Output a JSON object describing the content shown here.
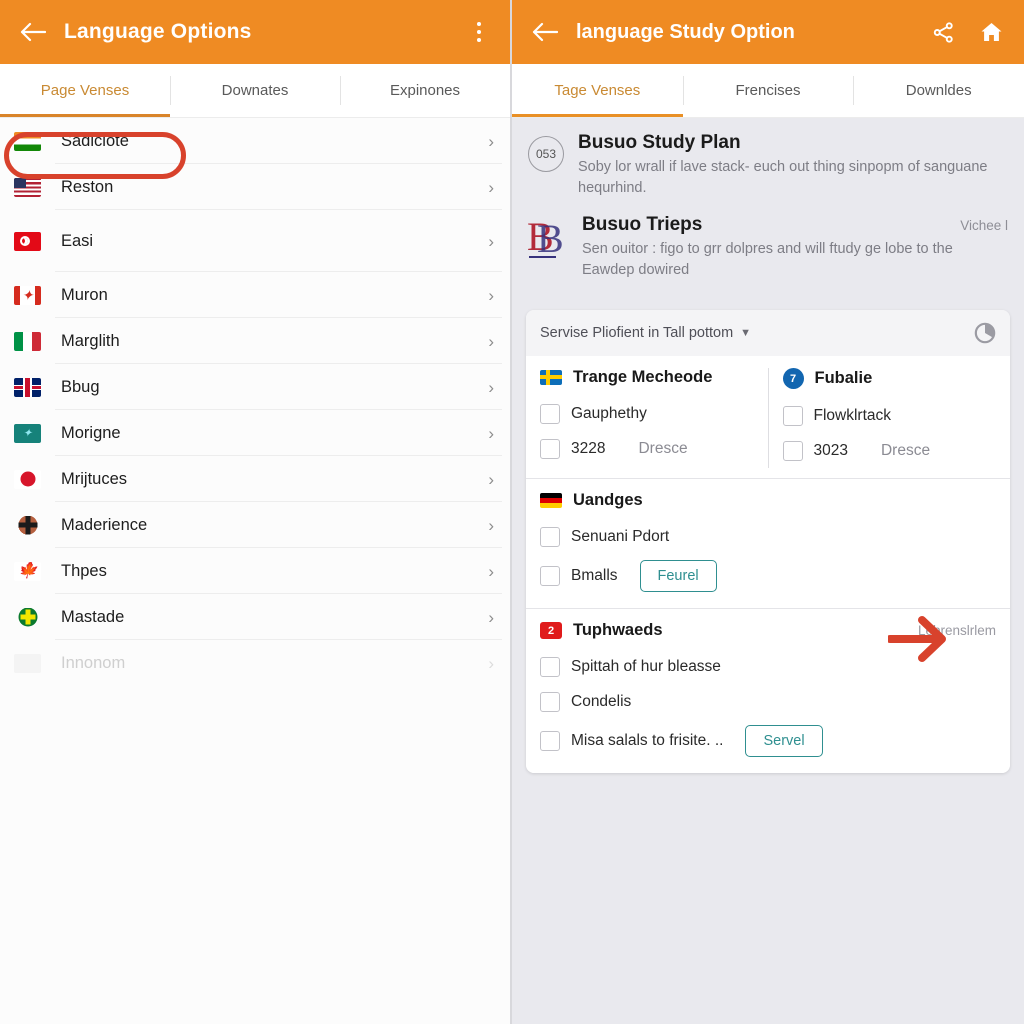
{
  "left": {
    "appbar": {
      "back_icon": "back-arrow-icon",
      "title": "Language Options",
      "overflow_icon": "more-vertical-icon"
    },
    "tabs": [
      {
        "label": "Page Venses",
        "active": true
      },
      {
        "label": "Downates",
        "active": false
      },
      {
        "label": "Expinones",
        "active": false
      }
    ],
    "highlight_color": "#d8422c",
    "languages": [
      {
        "label": "Sadiclote",
        "flag": "india-flag-icon",
        "highlighted": true,
        "faded": false,
        "chevron": "chevron-right-icon"
      },
      {
        "label": "Reston",
        "flag": "usa-flag-icon",
        "highlighted": false,
        "faded": false,
        "chevron": "chevron-right-icon"
      },
      {
        "label": "Easi",
        "flag": "turkey-flag-icon",
        "highlighted": false,
        "faded": false,
        "chevron": "chevron-right-icon"
      },
      {
        "label": "Muron",
        "flag": "canada-flag-icon",
        "highlighted": false,
        "faded": false,
        "chevron": "chevron-right-icon"
      },
      {
        "label": "Marglith",
        "flag": "italy-flag-icon",
        "highlighted": false,
        "faded": false,
        "chevron": "chevron-right-icon"
      },
      {
        "label": "Bbug",
        "flag": "uk-flag-icon",
        "highlighted": false,
        "faded": false,
        "chevron": "chevron-right-icon"
      },
      {
        "label": "Morigne",
        "flag": "teal-flag-icon",
        "highlighted": false,
        "faded": false,
        "chevron": "chevron-right-icon"
      },
      {
        "label": "Mrijtuces",
        "flag": "japan-flag-icon",
        "highlighted": false,
        "faded": false,
        "chevron": "chevron-right-icon"
      },
      {
        "label": "Maderience",
        "flag": "dark-cross-flag-icon",
        "highlighted": false,
        "faded": false,
        "chevron": "chevron-right-icon"
      },
      {
        "label": "Thpes",
        "flag": "maple-leaf-flag-icon",
        "highlighted": false,
        "faded": false,
        "chevron": "chevron-right-icon"
      },
      {
        "label": "Mastade",
        "flag": "green-cross-flag-icon",
        "highlighted": false,
        "faded": false,
        "chevron": "chevron-right-icon"
      },
      {
        "label": "Innonom",
        "flag": "grey-flag-icon",
        "highlighted": false,
        "faded": true,
        "chevron": "chevron-right-icon"
      }
    ]
  },
  "right": {
    "appbar": {
      "back_icon": "back-arrow-icon",
      "title": "language Study Option",
      "share_icon": "share-icon",
      "home_icon": "home-icon"
    },
    "tabs": [
      {
        "label": "Tage Venses",
        "active": true
      },
      {
        "label": "Frencises",
        "active": false
      },
      {
        "label": "Downldes",
        "active": false
      }
    ],
    "plan": {
      "badge": "053",
      "title": "Busuo Study Plan",
      "desc": "Soby lor wrall if lave stack- euch out thing sinpopm of sanguane hequrhind."
    },
    "trips": {
      "logo": "busuo-b-logo",
      "title": "Busuo Trieps",
      "right_label": "Vichee l",
      "desc": "Sen ouitor : figo to grr dolpres and will ftudy ge lobe to the Eawdep dowired"
    },
    "card": {
      "filter_label": "Servise Pliofient in Tall pottom",
      "caret_icon": "chevron-down-icon",
      "chart_icon": "pie-chart-icon",
      "sections": [
        {
          "layout": "two-column",
          "columns": [
            {
              "icon": "sweden-flag-icon",
              "title": "Trange Mecheode",
              "rows": [
                {
                  "checkbox": true,
                  "label": "Gauphethy",
                  "sub": ""
                },
                {
                  "checkbox": true,
                  "label": "3228",
                  "sub": "Dresce"
                }
              ]
            },
            {
              "icon": "blue-circle-badge-icon",
              "icon_text": "7",
              "title": "Fubalie",
              "rows": [
                {
                  "checkbox": true,
                  "label": "Flowklrtack",
                  "sub": ""
                },
                {
                  "checkbox": true,
                  "label": "3023",
                  "sub": "Dresce"
                }
              ]
            }
          ]
        },
        {
          "layout": "single",
          "icon": "germany-flag-icon",
          "title": "Uandges",
          "right_label": "",
          "rows": [
            {
              "checkbox": true,
              "label": "Senuani Pdort",
              "button": ""
            },
            {
              "checkbox": true,
              "label": "Bmalls",
              "button": "Feurel"
            }
          ]
        },
        {
          "layout": "single",
          "icon": "red-badge-icon",
          "icon_text": "2",
          "title": "Tuphwaeds",
          "right_label": "Lebrenslrlem",
          "rows": [
            {
              "checkbox": true,
              "label": "Spittah of hur bleasse",
              "button": ""
            },
            {
              "checkbox": true,
              "label": "Condelis",
              "button": ""
            },
            {
              "checkbox": true,
              "label": "Misa salals to frisite. ..",
              "button": "Servel"
            }
          ]
        }
      ]
    },
    "annotation": {
      "arrow_icon": "red-arrow-pointer",
      "color": "#d8422c"
    }
  },
  "theme": {
    "accent_orange": "#ef8b23",
    "panel_bg": "#e9e9ee",
    "teal_button": "#2f8f90",
    "annotation_red": "#d8422c"
  }
}
